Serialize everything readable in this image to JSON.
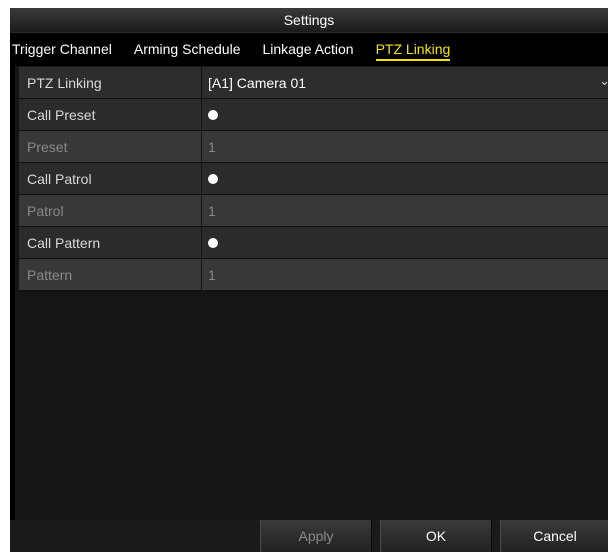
{
  "window": {
    "title": "Settings"
  },
  "tabs": [
    {
      "label": "Trigger Channel",
      "active": false
    },
    {
      "label": "Arming Schedule",
      "active": false
    },
    {
      "label": "Linkage Action",
      "active": false
    },
    {
      "label": "PTZ Linking",
      "active": true
    }
  ],
  "ptz": {
    "linking_label": "PTZ Linking",
    "camera_value": "[A1] Camera 01",
    "rows": [
      {
        "label": "Call Preset",
        "value": "",
        "type": "checkbox",
        "checked": true
      },
      {
        "label": "Preset",
        "value": "1",
        "type": "text"
      },
      {
        "label": "Call Patrol",
        "value": "",
        "type": "checkbox",
        "checked": true
      },
      {
        "label": "Patrol",
        "value": "1",
        "type": "text"
      },
      {
        "label": "Call Pattern",
        "value": "",
        "type": "checkbox",
        "checked": true
      },
      {
        "label": "Pattern",
        "value": "1",
        "type": "text"
      }
    ]
  },
  "buttons": {
    "apply": "Apply",
    "ok": "OK",
    "cancel": "Cancel"
  },
  "icons": {
    "dropdown": "chevron-down-icon",
    "checkbox": "radio-dot-icon"
  },
  "colors": {
    "active_tab": "#f5e600",
    "background": "#000000",
    "disabled_text": "#8a8a8a"
  }
}
